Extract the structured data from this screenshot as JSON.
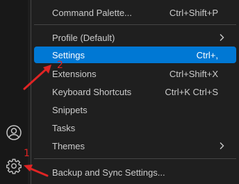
{
  "activity_bar": {
    "icons": [
      "account-icon",
      "manage-gear-icon"
    ]
  },
  "menu": {
    "items": [
      {
        "label": "Command Palette...",
        "shortcut": "Ctrl+Shift+P"
      },
      {
        "label": "Profile (Default)",
        "shortcut": ""
      },
      {
        "label": "Settings",
        "shortcut": "Ctrl+,"
      },
      {
        "label": "Extensions",
        "shortcut": "Ctrl+Shift+X"
      },
      {
        "label": "Keyboard Shortcuts",
        "shortcut": "Ctrl+K Ctrl+S"
      },
      {
        "label": "Snippets",
        "shortcut": ""
      },
      {
        "label": "Tasks",
        "shortcut": ""
      },
      {
        "label": "Themes",
        "shortcut": ""
      },
      {
        "label": "Backup and Sync Settings...",
        "shortcut": ""
      }
    ],
    "active_item": "Settings"
  },
  "annotations": {
    "step1": "1",
    "step2": "2",
    "color": "#e02424"
  },
  "colors": {
    "menu_bg": "#1f1f1f",
    "highlight": "#0078d4",
    "text": "#cccccc",
    "separator": "#454545"
  }
}
